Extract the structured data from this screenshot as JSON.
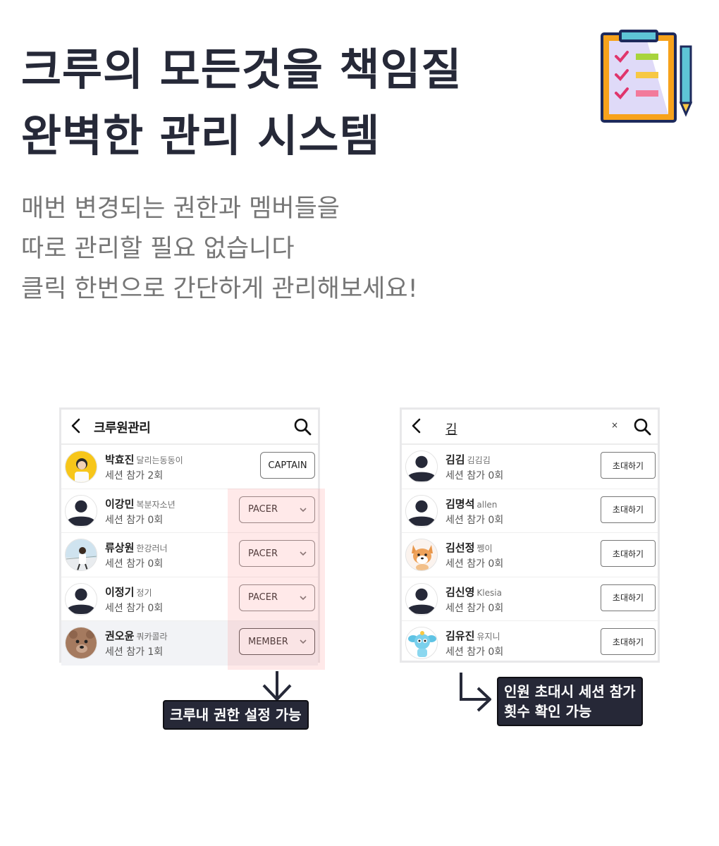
{
  "headline": [
    "크루의 모든것을 책임질",
    "완벽한 관리 시스템"
  ],
  "subtext": [
    "매번 변경되는 권한과 멤버들을",
    "따로 관리할 필요 없습니다",
    "클릭 한번으로 간단하게 관리해보세요!"
  ],
  "crew_screen": {
    "title": "크루원관리",
    "members": [
      {
        "name": "박효진",
        "nickname": "달리는동동이",
        "sessions": "세션 참가 2회",
        "role": "CAPTAIN",
        "avatar": "yellow-photo"
      },
      {
        "name": "이강민",
        "nickname": "복분자소년",
        "sessions": "세션 참가 0회",
        "role": "PACER",
        "avatar": "default-person"
      },
      {
        "name": "류상원",
        "nickname": "한강러너",
        "sessions": "세션 참가 0회",
        "role": "PACER",
        "avatar": "runner-photo"
      },
      {
        "name": "이정기",
        "nickname": "정기",
        "sessions": "세션 참가 0회",
        "role": "PACER",
        "avatar": "default-person"
      },
      {
        "name": "권오윤",
        "nickname": "쿼카콜라",
        "sessions": "세션 참가 1회",
        "role": "MEMBER",
        "avatar": "bear"
      }
    ]
  },
  "invite_screen": {
    "search_query": "김",
    "clear_label": "×",
    "results": [
      {
        "name": "김김",
        "nickname": "김김김",
        "sessions": "세션 참가 0회",
        "button": "초대하기",
        "avatar": "default-person"
      },
      {
        "name": "김명석",
        "nickname": "allen",
        "sessions": "세션 참가 0회",
        "button": "초대하기",
        "avatar": "default-person"
      },
      {
        "name": "김선정",
        "nickname": "쩽이",
        "sessions": "세션 참가 0회",
        "button": "초대하기",
        "avatar": "corgi"
      },
      {
        "name": "김신영",
        "nickname": "Klesia",
        "sessions": "세션 참가 0회",
        "button": "초대하기",
        "avatar": "default-person"
      },
      {
        "name": "김유진",
        "nickname": "유지니",
        "sessions": "세션 참가 0회",
        "button": "초대하기",
        "avatar": "blue-character"
      }
    ]
  },
  "labels": {
    "role_setting": "크루내 권한 설정 가능",
    "invite_check": [
      "인원 초대시 세션 참가",
      "횟수 확인 가능"
    ]
  },
  "colors": {
    "navy": "#262938",
    "highlight": "#ff7878",
    "gray_text": "#767676"
  }
}
